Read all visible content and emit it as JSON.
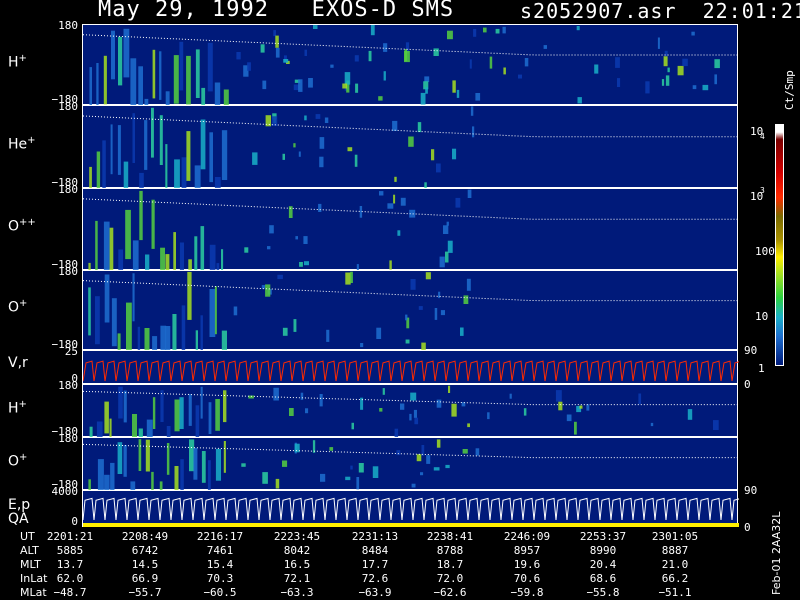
{
  "header": {
    "title": "May 29, 1992   EXOS-D SMS",
    "file": "s2052907.asr  22:01:21"
  },
  "colors": {
    "background": "#001a7a",
    "axis": "#ffffff",
    "velocity_trace": "#ff2a00",
    "qa_fill": "#ffee00"
  },
  "chart_data": {
    "type": "heatmap",
    "panels": [
      {
        "label": "H",
        "charge": "+",
        "ytick_top": "180",
        "ytick_bottom": "−180"
      },
      {
        "label": "He",
        "charge": "+",
        "ytick_top": "180",
        "ytick_bottom": "−180"
      },
      {
        "label": "O",
        "charge": "++",
        "ytick_top": "180",
        "ytick_bottom": "−180"
      },
      {
        "label": "O",
        "charge": "+",
        "ytick_top": "180",
        "ytick_bottom": "−180",
        "right_tick": "90"
      },
      {
        "label": "V,r",
        "charge": "",
        "ytick_top": "25",
        "ytick_bottom": "0",
        "right_tick": "0"
      },
      {
        "label": "H",
        "charge": "+",
        "ytick_top": "180",
        "ytick_bottom": "−180"
      },
      {
        "label": "O",
        "charge": "+",
        "ytick_top": "180",
        "ytick_bottom": "−180",
        "right_tick": "90"
      },
      {
        "label": "E,p",
        "label2": "QA",
        "charge": "",
        "ytick_top": "4000",
        "ytick_bottom": "0",
        "right_tick": "0"
      }
    ],
    "colorbar": {
      "title": "Ct/Smp",
      "labels": [
        "10",
        "4",
        "10",
        "3",
        "100",
        "10",
        "1"
      ]
    },
    "footer": {
      "rows": [
        {
          "name": "UT",
          "values": [
            "2201:21",
            "2208:49",
            "2216:17",
            "2223:45",
            "2231:13",
            "2238:41",
            "2246:09",
            "2253:37",
            "2301:05"
          ]
        },
        {
          "name": "ALT",
          "values": [
            "5885",
            "6742",
            "7461",
            "8042",
            "8484",
            "8788",
            "8957",
            "8990",
            "8887"
          ]
        },
        {
          "name": "MLT",
          "values": [
            "13.7",
            "14.5",
            "15.4",
            "16.5",
            "17.7",
            "18.7",
            "19.6",
            "20.4",
            "21.0"
          ]
        },
        {
          "name": "InLat",
          "values": [
            "62.0",
            "66.9",
            "70.3",
            "72.1",
            "72.6",
            "72.0",
            "70.6",
            "68.6",
            "66.2"
          ]
        },
        {
          "name": "MLat",
          "values": [
            "−48.7",
            "−55.7",
            "−60.5",
            "−63.3",
            "−63.9",
            "−62.6",
            "−59.8",
            "−55.8",
            "−51.1"
          ]
        }
      ],
      "side_note": "Feb-01 2AA32L"
    }
  }
}
